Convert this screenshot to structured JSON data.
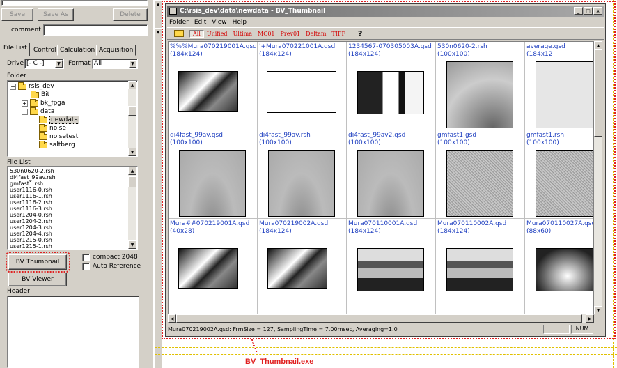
{
  "left_panel": {
    "buttons": {
      "save": "Save",
      "save_as": "Save As",
      "delete": "Delete"
    },
    "comment_label": "comment",
    "tabs": [
      "File List",
      "Control",
      "Calculation",
      "Acquisition"
    ],
    "drive_label": "Drive",
    "drive_value": "[- C -]",
    "format_label": "Format",
    "format_value": "All",
    "folder_label": "Folder",
    "folder_tree": [
      "rsis_dev",
      "Bit",
      "bk_fpga",
      "data",
      "newdata",
      "noise",
      "noisetest",
      "saltberg"
    ],
    "file_list_label": "File List",
    "file_list": [
      "530n0620-2.rsh",
      "di4fast_99av.rsh",
      "gmfast1.rsh",
      "user1116-0.rsh",
      "user1116-1.rsh",
      "user1116-2.rsh",
      "user1116-3.rsh",
      "user1204-0.rsh",
      "user1204-2.rsh",
      "user1204-3.rsh",
      "user1204-4.rsh",
      "user1215-0.rsh",
      "user1215-1.rsh"
    ],
    "bv_thumbnail_button": "BV Thumbnail",
    "bv_viewer_button": "BV Viewer",
    "compact_label": "compact 2048",
    "auto_reference_label": "Auto Reference",
    "header_label": "Header"
  },
  "window": {
    "title": "C:\\rsis_dev\\data\\newdata - BV_Thumbnail",
    "menu": [
      "Folder",
      "Edit",
      "View",
      "Help"
    ],
    "toolbar": [
      "All",
      "Unified",
      "Ultima",
      "MC01",
      "Prev01",
      "Deltam",
      "TIFF"
    ],
    "thumbnails": [
      {
        "name": "%%%Mura070219001A.qsd",
        "size": "(184x124)"
      },
      {
        "name": "'+Mura070221001A.qsd",
        "size": "(184x124)"
      },
      {
        "name": "1234567-070305003A.qsd",
        "size": "(184x124)"
      },
      {
        "name": "530n0620-2.rsh",
        "size": "(100x100)"
      },
      {
        "name": "average.gsd",
        "size": "(184x12"
      },
      {
        "name": "di4fast_99av.qsd",
        "size": "(100x100)"
      },
      {
        "name": "di4fast_99av.rsh",
        "size": "(100x100)"
      },
      {
        "name": "di4fast_99av2.qsd",
        "size": "(100x100)"
      },
      {
        "name": "gmfast1.gsd",
        "size": "(100x100)"
      },
      {
        "name": "gmfast1.rsh",
        "size": "(100x100)"
      },
      {
        "name": "Mura##070219001A.qsd",
        "size": "(40x28)"
      },
      {
        "name": "Mura070219002A.qsd",
        "size": "(184x124)"
      },
      {
        "name": "Mura070110001A.qsd",
        "size": "(184x124)"
      },
      {
        "name": "Mura070110002A.qsd",
        "size": "(184x124)"
      },
      {
        "name": "Mura070110027A.qsd",
        "size": "(88x60)"
      }
    ],
    "status_text": "Mura070219002A.qsd: FrmSize = 127, SamplingTime = 7.00msec, Averaging=1.0",
    "num_indicator": "NUM"
  },
  "annotation": "BV_Thumbnail.exe",
  "colors": {
    "highlight": "#e02020",
    "caption": "#2040c0",
    "face": "#d4d0c8"
  }
}
